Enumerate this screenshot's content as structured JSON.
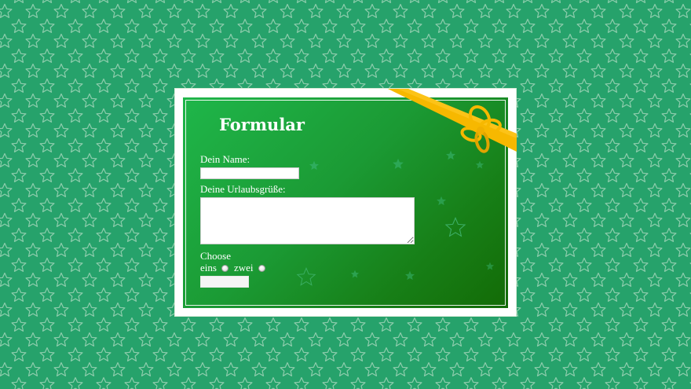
{
  "form": {
    "title": "Formular",
    "name_label": "Dein Name:",
    "name_value": "",
    "greeting_label": "Deine Urlaubsgrüße:",
    "greeting_value": "",
    "choose_label": "Choose",
    "options": [
      {
        "label": "eins",
        "checked": false
      },
      {
        "label": "zwei",
        "checked": false
      }
    ],
    "submit_label": ""
  },
  "decor": {
    "background_pattern": "star-icon",
    "ribbon": "bow-ribbon-icon"
  },
  "colors": {
    "page_background": "#26a26b",
    "card_gradient_start": "#1fb64a",
    "card_gradient_end": "#136b06",
    "ribbon": "#f7b800",
    "text": "#ffffff"
  }
}
